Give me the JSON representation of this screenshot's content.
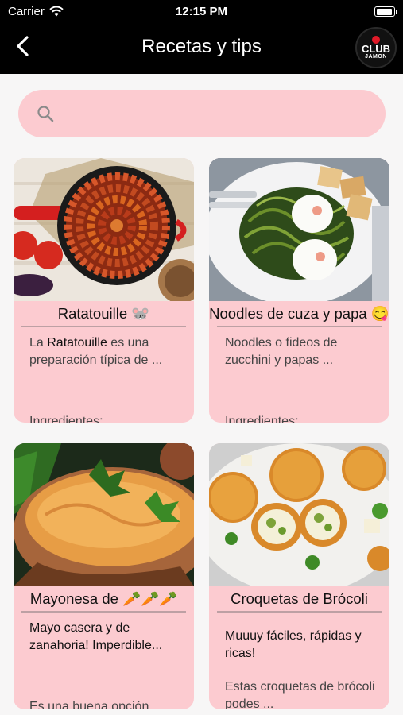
{
  "status_bar": {
    "carrier": "Carrier",
    "time": "12:15 PM"
  },
  "nav": {
    "title": "Recetas y tips",
    "logo_line1": "CLUB",
    "logo_line2": "JAMON"
  },
  "search": {
    "placeholder": ""
  },
  "cards": [
    {
      "title": "Ratatouille 🐭",
      "desc_bold": "Ratatouille",
      "desc_pre": "La ",
      "desc_post": " es una preparación típica de ...",
      "footer": "Ingredientes:"
    },
    {
      "title": "Noodles de cuza y papa 😋",
      "desc": "Noodles o fideos de zucchini y papas ...",
      "footer": "Ingredientes:"
    },
    {
      "title": "Mayonesa de 🥕🥕🥕",
      "desc": "Mayo casera y de zanahoria! Imperdible...",
      "footer": "Es una buena opción"
    },
    {
      "title": "Croquetas de Brócoli",
      "desc": "Muuuy fáciles, rápidas y ricas!",
      "desc2": "Estas croquetas de brócoli podes ..."
    }
  ],
  "colors": {
    "accent": "#fccbd0",
    "navbar": "#000000",
    "brand_red": "#e11a28"
  }
}
